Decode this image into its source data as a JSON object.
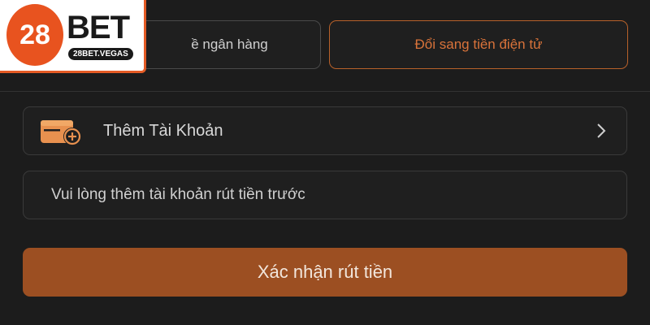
{
  "logo": {
    "number": "28",
    "brand": "BET",
    "domain": "28BET.VEGAS"
  },
  "tabs": {
    "bank_label": "Đổi về ngân hàng",
    "bank_visible_label": "ề ngân hàng",
    "crypto_label": "Đổi sang tiền điện tử"
  },
  "account": {
    "add_label": "Thêm Tài Khoản",
    "note": "Vui lòng thêm tài khoản rút tiền trước"
  },
  "confirm": {
    "label": "Xác nhận rút tiền"
  },
  "colors": {
    "accent": "#e8531f",
    "button": "#9c4f22",
    "background": "#1c1c1c"
  },
  "icons": {
    "wallet": "wallet-add-icon",
    "chevron": "chevron-right-icon"
  }
}
